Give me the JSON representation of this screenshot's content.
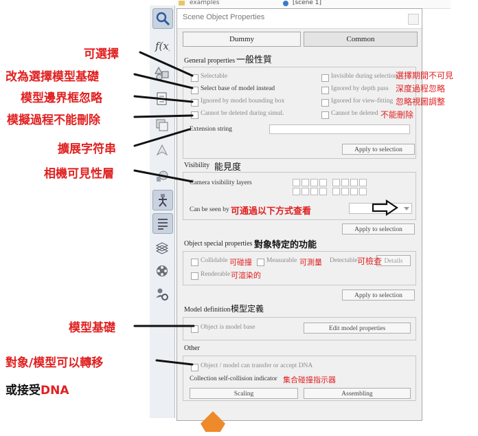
{
  "background_snippet": {
    "left_tree_item": "examples",
    "right_tree_item": "[scene 1]"
  },
  "dialog": {
    "title": "Scene Object Properties",
    "tabs": [
      "Dummy",
      "Common"
    ],
    "general": {
      "title": "General properties",
      "checkboxes_left": [
        "Selectable",
        "Select base of model instead",
        "Ignored by model bounding box",
        "Cannot be deleted during simul."
      ],
      "checkboxes_right": [
        "Invisible during selection",
        "Ignored by depth pass",
        "Ignored for view-fitting",
        "Cannot be deleted"
      ],
      "extension_label": "Extension string",
      "apply_label": "Apply to selection"
    },
    "visibility": {
      "title": "Visibility",
      "layers_label": "Camera visibility layers",
      "seen_by_label": "Can be seen by",
      "apply_label": "Apply to selection"
    },
    "special": {
      "title": "Object special properties",
      "collidable": "Collidable",
      "measurable": "Measurable",
      "detectable": "Detectable",
      "details": "Details",
      "renderable": "Renderable",
      "apply_label": "Apply to selection"
    },
    "model": {
      "title": "Model definition",
      "is_model_base": "Object is model base",
      "edit_button": "Edit model properties"
    },
    "other": {
      "title": "Other",
      "dna": "Object / model can transfer or accept DNA",
      "collision_label": "Collection self-collision indicator",
      "scaling_button": "Scaling",
      "assembling_button": "Assembling"
    }
  },
  "annotations_inner": {
    "general": "一般性質",
    "invisible_sel": "選擇期間不可見",
    "depth": "深度過程忽略",
    "view_fit": "忽略視圖調整",
    "no_delete": "不能刪除",
    "visibility": "能見度",
    "seen_by": "可通過以下方式查看",
    "special": "對象特定的功能",
    "collidable": "可碰撞",
    "measurable": "可測量",
    "detectable": "可檢查",
    "renderable": "可渲染的",
    "model_def": "模型定義",
    "collision": "集合碰撞指示器"
  },
  "annotations_outer": {
    "selectable": "可選擇",
    "select_base": "改為選擇模型基礎",
    "ignore_bbox": "模型邊界框忽略",
    "no_delete_sim": "模擬過程不能刪除",
    "extension": "擴展字符串",
    "camera_layers": "相機可見性層",
    "model_base": "模型基礎",
    "dna_line1": "對象/模型可以轉移",
    "dna_line2_prefix": "或接受",
    "dna_line2_suffix": "DNA"
  },
  "colors": {
    "annotation_red": "#e02020",
    "annotation_black": "#111111",
    "dialog_bg": "#f0f0f0"
  }
}
